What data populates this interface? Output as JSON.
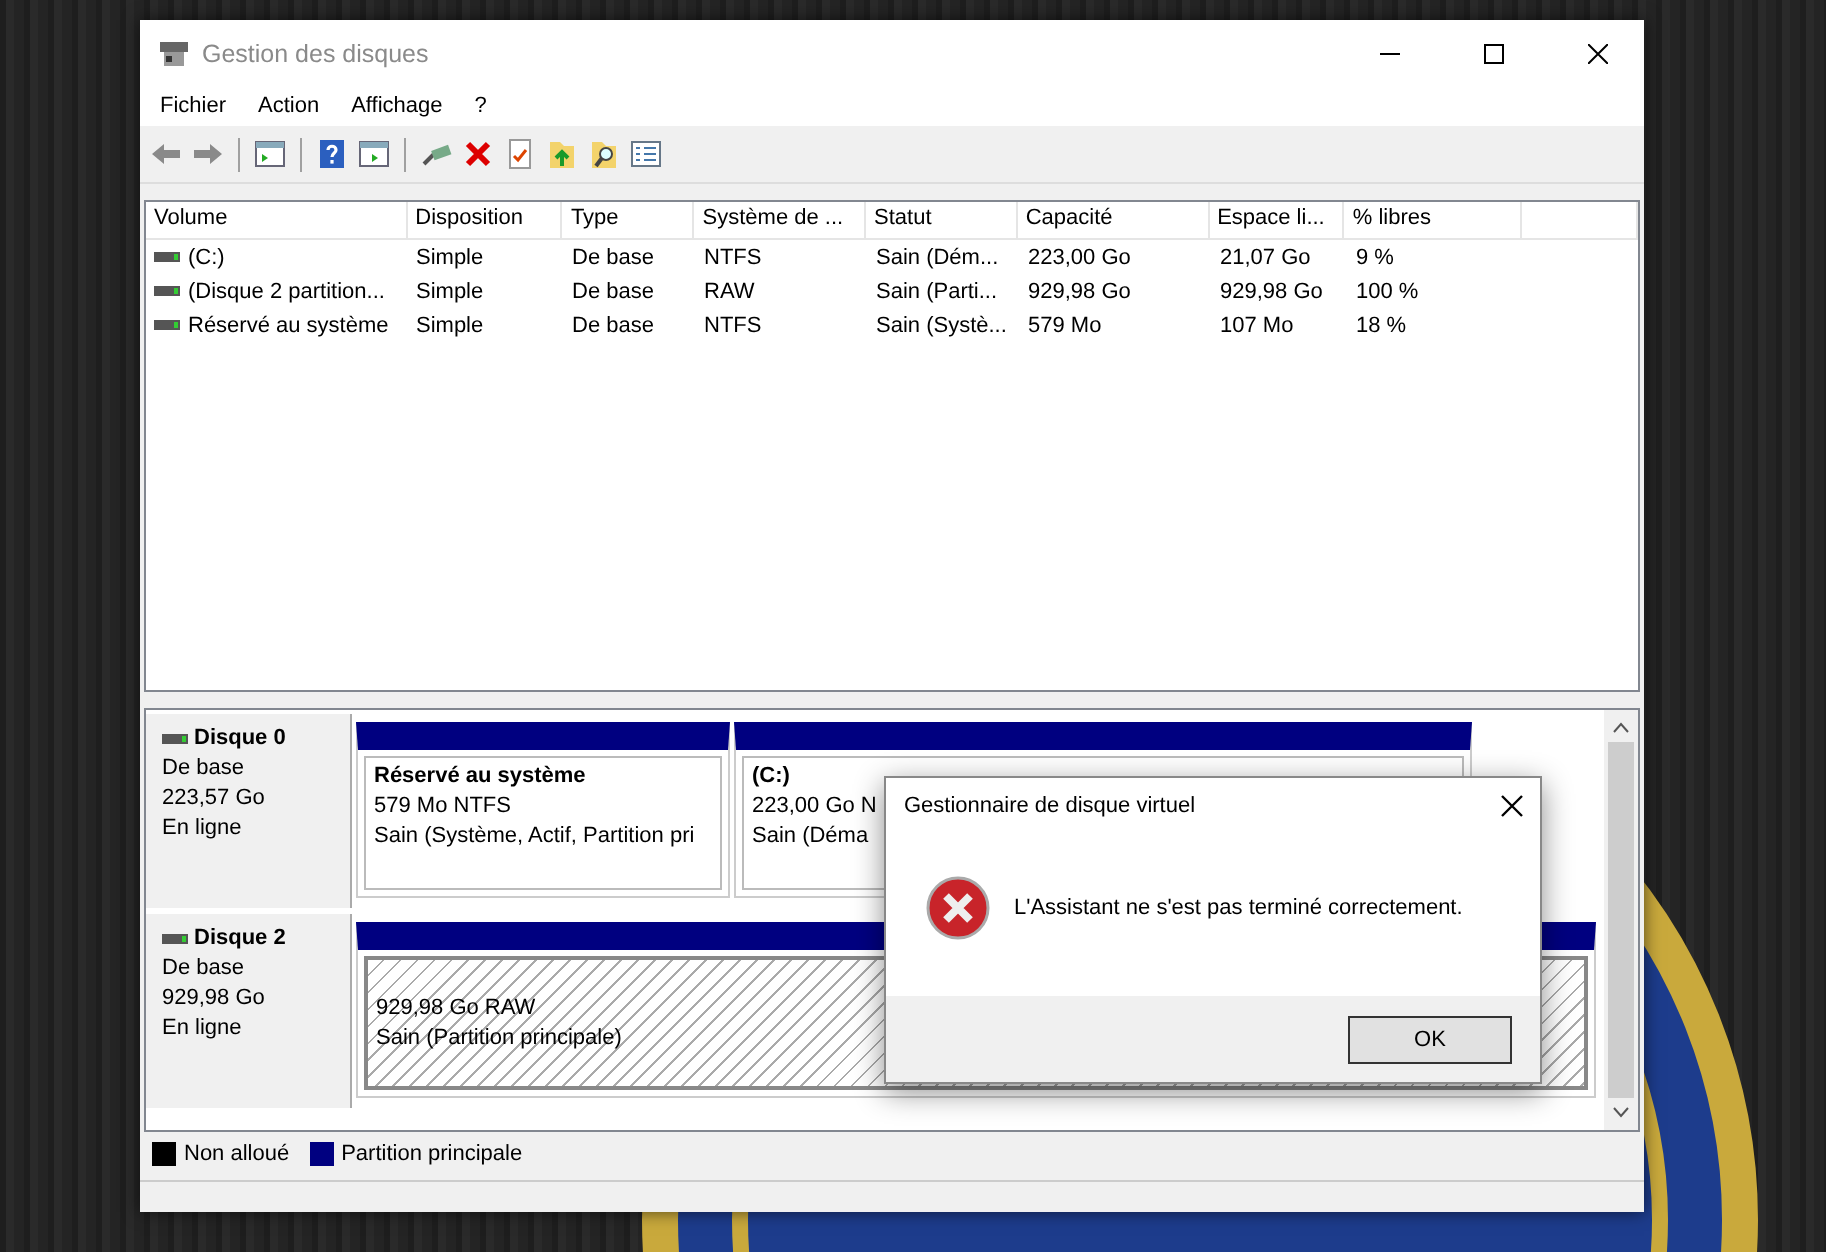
{
  "window": {
    "title": "Gestion des disques"
  },
  "menu": [
    "Fichier",
    "Action",
    "Affichage",
    "?"
  ],
  "volumes": {
    "columns": [
      "Volume",
      "Disposition",
      "Type",
      "Système de ...",
      "Statut",
      "Capacité",
      "Espace li...",
      "% libres"
    ],
    "rows": [
      [
        "(C:)",
        "Simple",
        "De base",
        "NTFS",
        "Sain (Dém...",
        "223,00 Go",
        "21,07 Go",
        "9 %"
      ],
      [
        "(Disque 2 partition...",
        "Simple",
        "De base",
        "RAW",
        "Sain (Parti...",
        "929,98 Go",
        "929,98 Go",
        "100 %"
      ],
      [
        "Réservé au système",
        "Simple",
        "De base",
        "NTFS",
        "Sain (Systè...",
        "579 Mo",
        "107 Mo",
        "18 %"
      ]
    ]
  },
  "disks": [
    {
      "name": "Disque 0",
      "type": "De base",
      "size": "223,57 Go",
      "status": "En ligne",
      "partitions": [
        {
          "title": "Réservé au système",
          "size": "579 Mo NTFS",
          "health": "Sain (Système, Actif, Partition pri",
          "selected": false
        },
        {
          "title": "(C:)",
          "size": "223,00 Go N",
          "health": "Sain (Déma",
          "selected": false
        }
      ]
    },
    {
      "name": "Disque 2",
      "type": "De base",
      "size": "929,98 Go",
      "status": "En ligne",
      "partitions": [
        {
          "size": "929,98 Go RAW",
          "health": "Sain (Partition principale)",
          "selected": true
        }
      ]
    }
  ],
  "legend": [
    {
      "label": "Non alloué",
      "color": "#000000"
    },
    {
      "label": "Partition principale",
      "color": "#000080"
    }
  ],
  "dialog": {
    "title": "Gestionnaire de disque virtuel",
    "message": "L'Assistant ne s'est pas terminé correctement.",
    "button": "OK"
  }
}
